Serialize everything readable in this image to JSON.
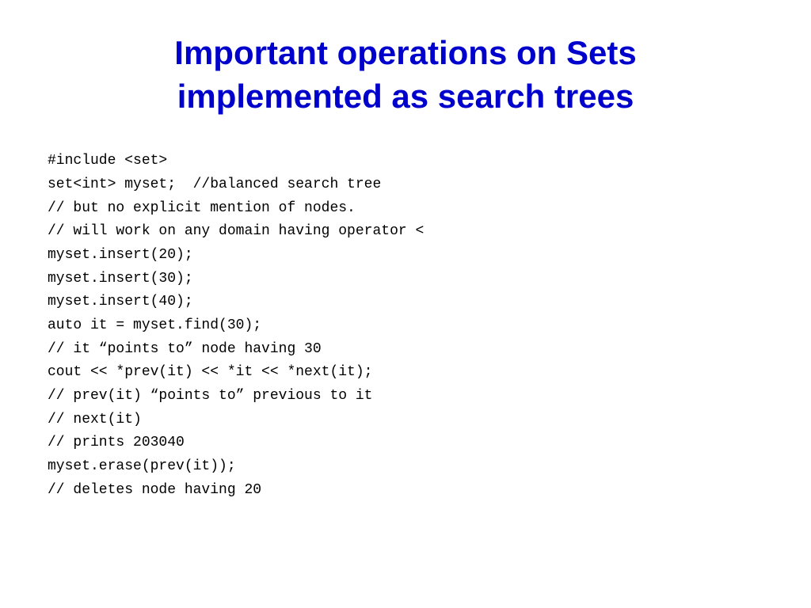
{
  "header": {
    "title_line1": "Important operations on Sets",
    "title_line2": "implemented as search trees"
  },
  "code": {
    "lines": [
      "#include <set>",
      "set<int> myset;  //balanced search tree",
      "// but no explicit mention of nodes.",
      "// will work on any domain having operator <",
      "myset.insert(20);",
      "myset.insert(30);",
      "myset.insert(40);",
      "auto it = myset.find(30);",
      "// it “points to” node having 30",
      "cout << *prev(it) << *it << *next(it);",
      "// prev(it) “points to” previous to it",
      "// next(it)",
      "// prints 203040",
      "myset.erase(prev(it));",
      "// deletes node having 20"
    ]
  }
}
